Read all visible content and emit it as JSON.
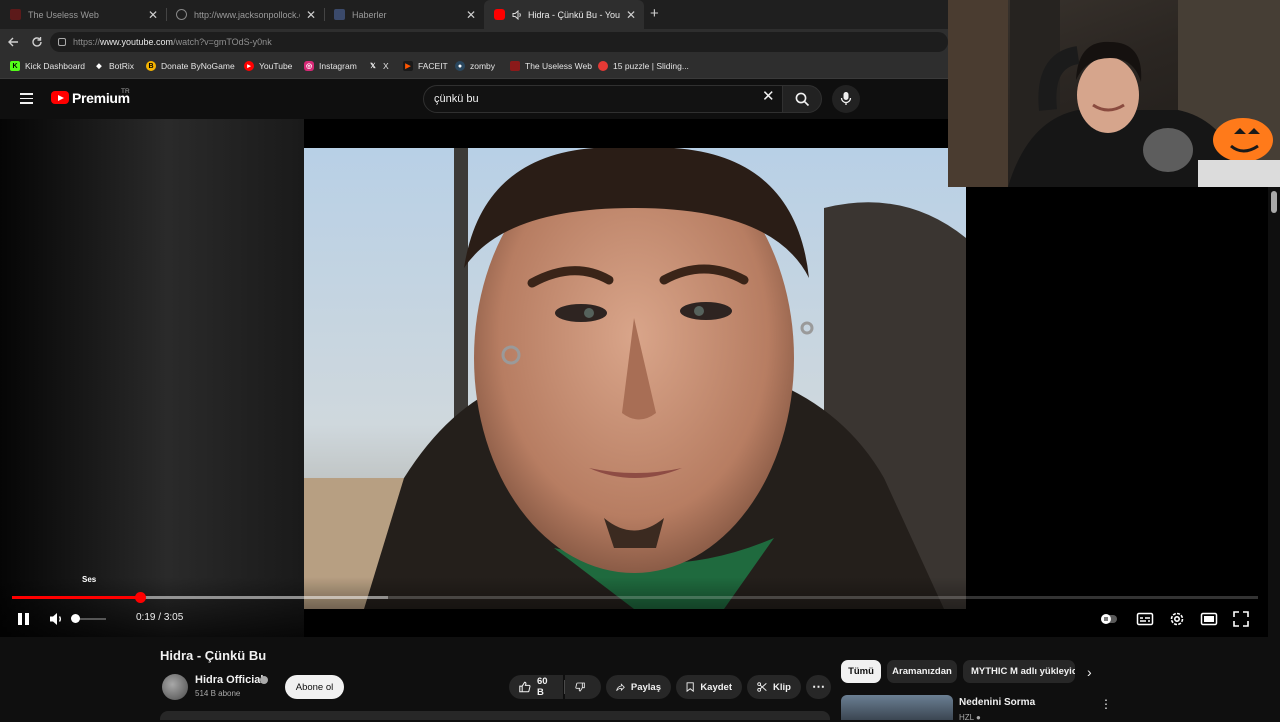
{
  "browser": {
    "tabs": [
      {
        "title": "The Useless Web",
        "favicon_color": "#5c1a1a",
        "active": false,
        "audio": false
      },
      {
        "title": "http://www.jacksonpollock.org/ by",
        "favicon_color": "#777777",
        "active": false,
        "audio": false
      },
      {
        "title": "Haberler",
        "favicon_color": "#3b4a6b",
        "active": false,
        "audio": false
      },
      {
        "title": "Hidra - Çünkü Bu - YouTube",
        "favicon_color": "#ff0000",
        "active": true,
        "audio": true
      }
    ],
    "address": {
      "scheme": "https://",
      "host": "www.youtube.com",
      "path": "/watch?v=gmTOdS-y0nk"
    },
    "bookmarks": [
      {
        "label": "Kick Dashboard",
        "icon": "kick-icon",
        "color": "#53fc18"
      },
      {
        "label": "BotRix",
        "icon": "botrix-icon",
        "color": "#ffffff"
      },
      {
        "label": "Donate ByNoGame",
        "icon": "bynogame-icon",
        "color": "#f5b400"
      },
      {
        "label": "YouTube",
        "icon": "youtube-icon",
        "color": "#ff0000"
      },
      {
        "label": "Instagram",
        "icon": "instagram-icon",
        "color": "#d62976"
      },
      {
        "label": "X",
        "icon": "x-icon",
        "color": "#000000"
      },
      {
        "label": "FACEIT",
        "icon": "faceit-icon",
        "color": "#ff5500"
      },
      {
        "label": "zomby",
        "icon": "steam-icon",
        "color": "#1b2838"
      },
      {
        "label": "The Useless Web",
        "icon": "uselessweb-icon",
        "color": "#8b1a1a"
      },
      {
        "label": "15 puzzle | Sliding...",
        "icon": "puzzle-icon",
        "color": "#e53935"
      }
    ]
  },
  "youtube": {
    "logo_text": "Premium",
    "region": "TR",
    "search_query": "çünkü bu"
  },
  "player": {
    "tooltip": "Ses",
    "current_time": "0:19",
    "duration": "3:05",
    "progress_fraction": 0.1027,
    "buffer_fraction": 0.302,
    "volume_fraction": 0.1
  },
  "watch": {
    "title": "Hidra - Çünkü Bu",
    "channel": "Hidra Official",
    "subscribers": "514 B abone",
    "subscribe_label": "Abone ol",
    "like_count": "60 B",
    "share_label": "Paylaş",
    "save_label": "Kaydet",
    "clip_label": "Klip"
  },
  "sidebar": {
    "chips": [
      "Tümü",
      "Aramanızdan",
      "MYTHIC M adlı yükleyici"
    ],
    "rec_title": "Nedenini Sorma",
    "rec_sub": "HZL ●"
  },
  "colors": {
    "accent": "#ff0000",
    "background": "#0f0f0f",
    "chip": "#272727"
  }
}
